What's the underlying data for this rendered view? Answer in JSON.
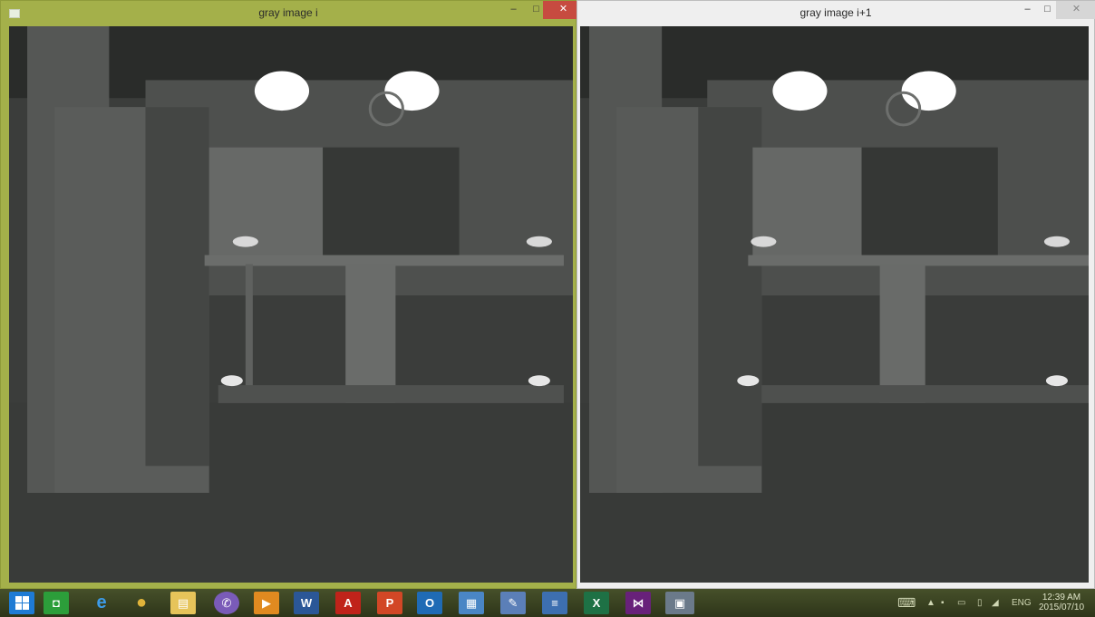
{
  "windows": [
    {
      "id": "left",
      "title": "gray image i",
      "active": true,
      "controls": {
        "minimize": "–",
        "maximize": "□",
        "close": "✕"
      }
    },
    {
      "id": "right",
      "title": "gray image i+1",
      "active": false,
      "controls": {
        "minimize": "–",
        "maximize": "□",
        "close": "✕"
      }
    }
  ],
  "taskbar": {
    "apps": [
      {
        "name": "start-button",
        "icon": "windows-logo-icon",
        "color": "#1e7bd4"
      },
      {
        "name": "store-app",
        "icon": "store-icon",
        "color": "#2c9e3a",
        "glyph": "◘"
      },
      {
        "name": "internet-explorer-app",
        "icon": "ie-icon",
        "color": "#1a6fc9",
        "glyph": "e"
      },
      {
        "name": "chrome-app",
        "icon": "chrome-icon",
        "color": "#d8a51f",
        "glyph": "●"
      },
      {
        "name": "file-explorer-app",
        "icon": "folder-icon",
        "color": "#e6c45a",
        "glyph": "▤"
      },
      {
        "name": "viber-app",
        "icon": "viber-icon",
        "color": "#7a5bb8",
        "glyph": "✆"
      },
      {
        "name": "media-app",
        "icon": "media-icon",
        "color": "#e08a20",
        "glyph": "▶"
      },
      {
        "name": "word-app",
        "icon": "word-icon",
        "color": "#2b5797",
        "glyph": "W"
      },
      {
        "name": "pdf-app",
        "icon": "pdf-icon",
        "color": "#c0231a",
        "glyph": "A"
      },
      {
        "name": "powerpoint-app",
        "icon": "powerpoint-icon",
        "color": "#d24726",
        "glyph": "P"
      },
      {
        "name": "outlook-app",
        "icon": "outlook-icon",
        "color": "#1f6bb5",
        "glyph": "O"
      },
      {
        "name": "photo-app",
        "icon": "photo-viewer-icon",
        "color": "#4a86c5",
        "glyph": "▦"
      },
      {
        "name": "paint-app",
        "icon": "paint-icon",
        "color": "#5b7fb8",
        "glyph": "✎"
      },
      {
        "name": "notepad-app",
        "icon": "notepad-icon",
        "color": "#3d6fb0",
        "glyph": "≡"
      },
      {
        "name": "excel-app",
        "icon": "excel-icon",
        "color": "#1e7145",
        "glyph": "X"
      },
      {
        "name": "visual-studio-app",
        "icon": "visual-studio-icon",
        "color": "#68217a",
        "glyph": "⋈"
      },
      {
        "name": "opencv-window-app",
        "icon": "window-icon",
        "color": "#6b7a8a",
        "glyph": "▣"
      }
    ],
    "tray": {
      "keyboard_icon": "keyboard-icon",
      "chevron": "▲",
      "language": "ENG",
      "time": "12:39 AM",
      "date": "2015/07/10"
    }
  }
}
